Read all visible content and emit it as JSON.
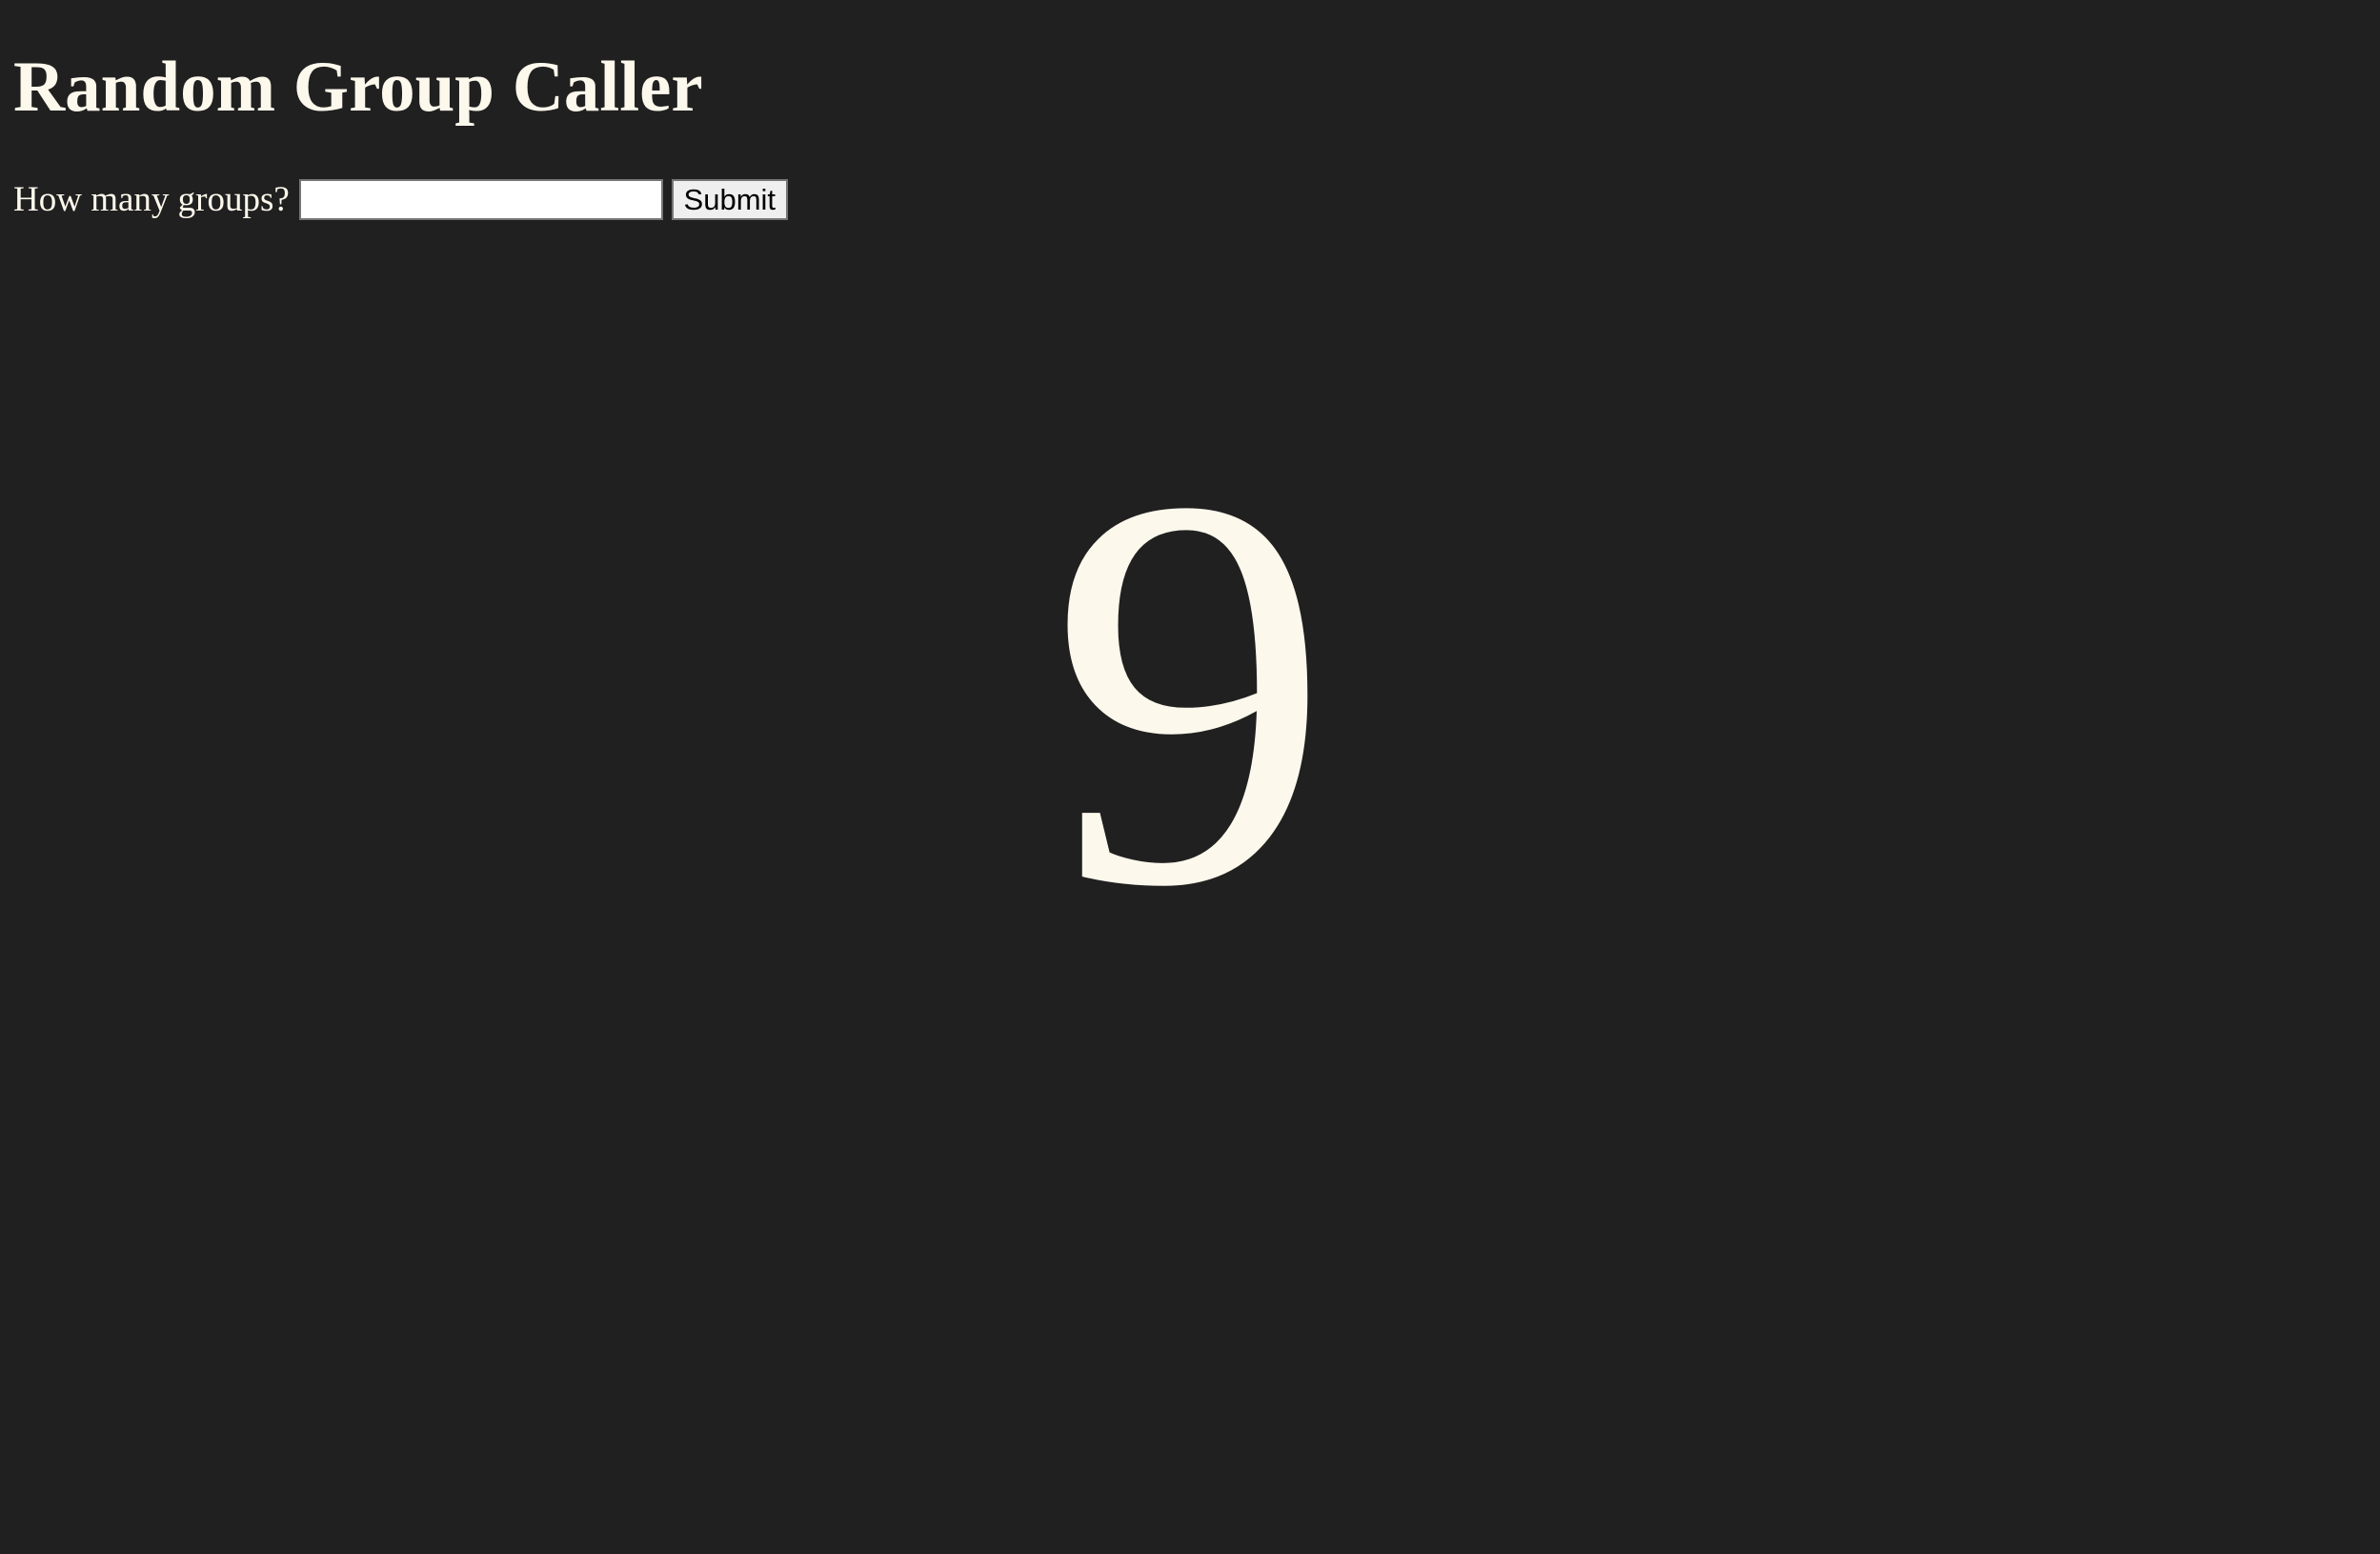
{
  "page": {
    "title": "Random Group Caller"
  },
  "form": {
    "label": "How many groups?",
    "input_value": "",
    "input_placeholder": "",
    "submit_label": "Submit"
  },
  "result": {
    "number": "9"
  },
  "colors": {
    "background": "#202020",
    "text": "#fdf8ec",
    "input_background": "#ffffff",
    "button_background": "#efefef"
  }
}
